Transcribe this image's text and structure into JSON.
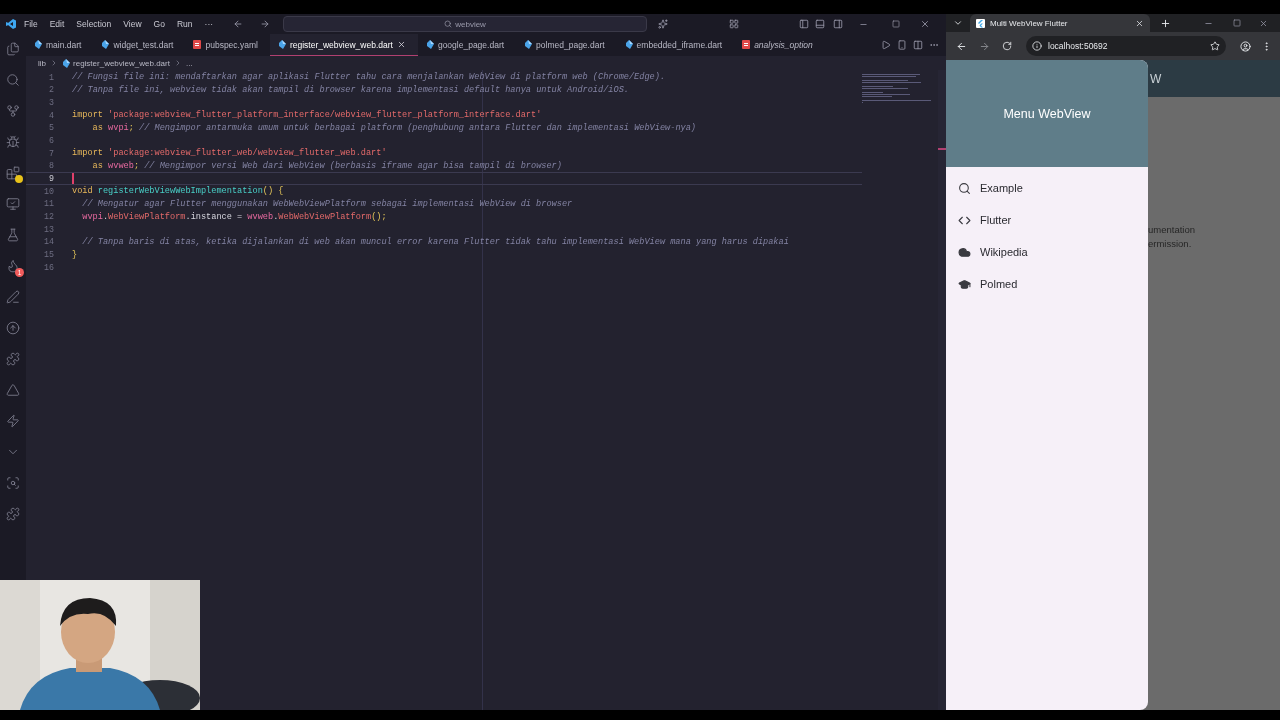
{
  "editor": {
    "menu": [
      "File",
      "Edit",
      "Selection",
      "View",
      "Go",
      "Run",
      "···"
    ],
    "command_center": {
      "value": "webview"
    },
    "activity_badge": "1",
    "tabs": [
      {
        "label": "main.dart",
        "kind": "dart",
        "selected": false,
        "italic": false
      },
      {
        "label": "widget_test.dart",
        "kind": "dart",
        "selected": false,
        "italic": false
      },
      {
        "label": "pubspec.yaml",
        "kind": "yaml",
        "selected": false,
        "italic": false
      },
      {
        "label": "register_webview_web.dart",
        "kind": "dart",
        "selected": true,
        "italic": false
      },
      {
        "label": "google_page.dart",
        "kind": "dart",
        "selected": false,
        "italic": false
      },
      {
        "label": "polmed_page.dart",
        "kind": "dart",
        "selected": false,
        "italic": false
      },
      {
        "label": "embedded_iframe.dart",
        "kind": "dart",
        "selected": false,
        "italic": false
      },
      {
        "label": "analysis_option",
        "kind": "yaml",
        "selected": false,
        "italic": true
      }
    ],
    "breadcrumb": [
      "lib",
      "register_webview_web.dart",
      "..."
    ],
    "lines": [
      {
        "number": "1",
        "kind": "top",
        "current": false,
        "tokens": [
          {
            "kind": "comment",
            "text": "// Fungsi file ini: mendaftarkan agar aplikasi Flutter tahu cara menjalankan WebView di platform web (Chrome/Edge)."
          }
        ]
      },
      {
        "number": "2",
        "kind": "top",
        "current": false,
        "tokens": [
          {
            "kind": "comment",
            "text": "// Tanpa file ini, webview tidak akan tampil di browser karena implementasi default hanya untuk Android/iOS."
          }
        ]
      },
      {
        "number": "3",
        "current": false
      },
      {
        "number": "4",
        "kind": "top",
        "current": false,
        "tokens": [
          {
            "kind": "keyword",
            "text": "import "
          },
          {
            "kind": "string",
            "text": "'package:webview_flutter_platform_interface/webview_flutter_platform_interface.dart'"
          }
        ]
      },
      {
        "number": "5",
        "kind": "continuation",
        "current": false,
        "tokens": [
          {
            "kind": "keyword",
            "text": "as "
          },
          {
            "kind": "ident",
            "text": "wvpi"
          },
          {
            "kind": "punct",
            "text": "; "
          },
          {
            "kind": "comment",
            "text": "// Mengimpor antarmuka umum untuk berbagai platform (penghubung antara Flutter dan implementasi WebView-nya)"
          }
        ]
      },
      {
        "number": "6",
        "current": false
      },
      {
        "number": "7",
        "kind": "top",
        "current": false,
        "tokens": [
          {
            "kind": "keyword",
            "text": "import "
          },
          {
            "kind": "string",
            "text": "'package:webview_flutter_web/webview_flutter_web.dart'"
          }
        ]
      },
      {
        "number": "8",
        "kind": "continuation",
        "current": false,
        "tokens": [
          {
            "kind": "keyword",
            "text": "as "
          },
          {
            "kind": "ident",
            "text": "wvweb"
          },
          {
            "kind": "punct",
            "text": "; "
          },
          {
            "kind": "comment",
            "text": "// Mengimpor versi Web dari WebView (berbasis iframe agar bisa tampil di browser)"
          }
        ]
      },
      {
        "number": "9",
        "current": true
      },
      {
        "number": "10",
        "kind": "top",
        "current": false,
        "tokens": [
          {
            "kind": "keyword",
            "text": "void "
          },
          {
            "kind": "func",
            "text": "registerWebViewWebImplementation"
          },
          {
            "kind": "punct",
            "text": "() {"
          }
        ]
      },
      {
        "number": "11",
        "kind": "body",
        "current": false,
        "tokens": [
          {
            "kind": "comment",
            "text": "// Mengatur agar Flutter menggunakan WebWebViewPlatform sebagai implementasi WebView di browser"
          }
        ]
      },
      {
        "number": "12",
        "kind": "body",
        "current": false,
        "tokens": [
          {
            "kind": "ident",
            "text": "wvpi"
          },
          {
            "kind": "plain",
            "text": "."
          },
          {
            "kind": "type",
            "text": "WebViewPlatform"
          },
          {
            "kind": "plain",
            "text": ".instance = "
          },
          {
            "kind": "ident",
            "text": "wvweb"
          },
          {
            "kind": "plain",
            "text": "."
          },
          {
            "kind": "type",
            "text": "WebWebViewPlatform"
          },
          {
            "kind": "punct",
            "text": "();"
          }
        ]
      },
      {
        "number": "13",
        "current": false
      },
      {
        "number": "14",
        "kind": "body",
        "current": false,
        "tokens": [
          {
            "kind": "comment",
            "text": "// Tanpa baris di atas, ketika dijalankan di web akan muncul error karena Flutter tidak tahu implementasi WebView mana yang harus dipakai"
          }
        ]
      },
      {
        "number": "15",
        "kind": "top",
        "current": false,
        "tokens": [
          {
            "kind": "punct",
            "text": "}"
          }
        ]
      },
      {
        "number": "16",
        "current": false
      }
    ]
  },
  "browser": {
    "tab_title": "Multi WebView Flutter",
    "address": "localhost:50692",
    "app_bar_title": "W",
    "body_lines": [
      "umentation",
      "ermission."
    ],
    "drawer": {
      "header": "Menu WebView",
      "items": [
        {
          "label": "Example",
          "kind": "search"
        },
        {
          "label": "Flutter",
          "kind": "code"
        },
        {
          "label": "Wikipedia",
          "kind": "cloud"
        },
        {
          "label": "Polmed",
          "kind": "school"
        }
      ]
    }
  }
}
